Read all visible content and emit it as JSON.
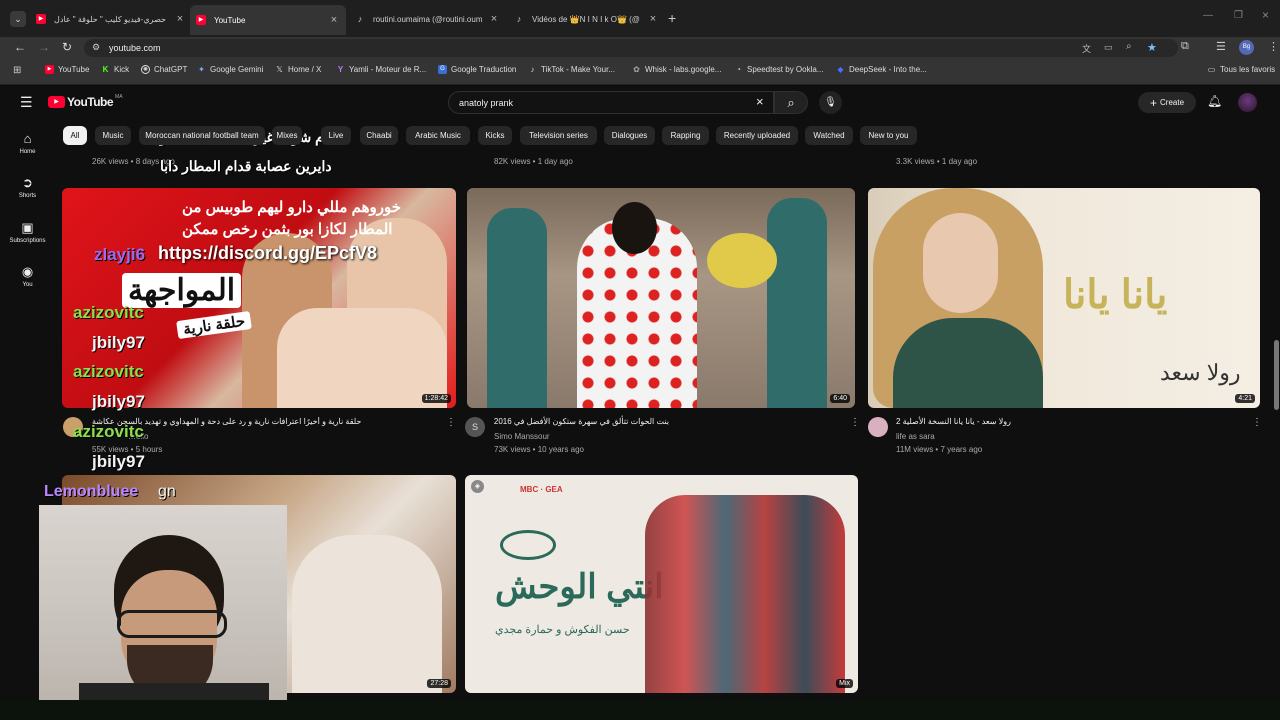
{
  "browser": {
    "tabs": [
      {
        "title": "حصري-فيديو كليب \" حلوفة \" عادل",
        "icon": "youtube-icon"
      },
      {
        "title": "YouTube",
        "icon": "youtube-icon"
      },
      {
        "title": "routini.oumaima (@routini.oum",
        "icon": "tiktok-icon"
      },
      {
        "title": "Vidéos de 👑N I N I k O👑 (@",
        "icon": "tiktok-icon"
      }
    ],
    "new_tab": "+",
    "address": "youtube.com",
    "bookmarks": [
      {
        "label": "YouTube",
        "icon": "youtube-icon"
      },
      {
        "label": "Kick",
        "icon": "kick-icon"
      },
      {
        "label": "ChatGPT",
        "icon": "chatgpt-icon"
      },
      {
        "label": "Google Gemini",
        "icon": "gemini-icon"
      },
      {
        "label": "Home / X",
        "icon": "x-icon"
      },
      {
        "label": "Yamli - Moteur de R...",
        "icon": "yamli-icon"
      },
      {
        "label": "Google Traduction",
        "icon": "translate-icon"
      },
      {
        "label": "TikTok - Make Your...",
        "icon": "tiktok-icon"
      },
      {
        "label": "Whisk - labs.google...",
        "icon": "whisk-icon"
      },
      {
        "label": "Speedtest by Ookla...",
        "icon": "speedtest-icon"
      },
      {
        "label": "DeepSeek - Into the...",
        "icon": "deepseek-icon"
      }
    ],
    "all_bookmarks": "Tous les favoris",
    "profile_initials": "Bg"
  },
  "youtube": {
    "logo": "YouTube",
    "country": "MA",
    "search_value": "anatoly prank",
    "create": "Create",
    "sidebar": [
      {
        "label": "Home",
        "icon": "home-icon"
      },
      {
        "label": "Shorts",
        "icon": "shorts-icon"
      },
      {
        "label": "Subscriptions",
        "icon": "subscriptions-icon"
      },
      {
        "label": "You",
        "icon": "you-icon"
      }
    ],
    "chips": [
      "All",
      "Music",
      "Moroccan national football team",
      "Mixes",
      "Live",
      "Chaabi",
      "Arabic Music",
      "Kicks",
      "Television series",
      "Dialogues",
      "Rapping",
      "Recently uploaded",
      "Watched",
      "New to you"
    ],
    "top_meta": [
      "26K views • 8 days ago",
      "82K views • 1 day ago",
      "3.3K views • 1 day ago"
    ],
    "videos": [
      {
        "title": "حلقة نارية و أخيرًا اعترافات نارية و رد على دحة و المهداوي و تهديد بالسجن عكاشة",
        "channel": "…ello",
        "meta": "55K views • 5 hours",
        "duration": "1:28:42"
      },
      {
        "title": "بنت الحوات تتألق في سهرة ستكون الأفضل في 2016",
        "channel": "Simo Manssour",
        "meta": "73K views • 10 years ago",
        "duration": "6:40"
      },
      {
        "title": "رولا سعد - يانا يانا النسخة الأصلية 2",
        "channel": "life as sara",
        "meta": "11M views • 7 years ago",
        "duration": "4:21"
      },
      {
        "duration": "27:28"
      },
      {
        "duration": "Mix"
      }
    ]
  },
  "overlay": {
    "discord": "https://discord.gg/EPcfV8",
    "headline1": "العام شوف غير الطاكسيات كانو",
    "headline2": "دايرين عصابة قدام المطار دابا",
    "thumb1_text1": "خوروهم مللي دارو ليهم طوبيس من",
    "thumb1_text2": "المطار لكازا بور بثمن رخص ممكن",
    "thumb1_big": "المواجهة",
    "thumb1_tag": "حلقة نارية",
    "thumb3_text": "يانا يانا",
    "thumb3_sub": "رولا سعد",
    "thumb5_title": "انتي الوحش",
    "thumb5_sub": "حسن الفكوش و حمارة مجدي",
    "chat": [
      "zlayji6",
      "azizovitc",
      "jbily97",
      "azizovitc",
      "jbily97",
      "azizovitc",
      "jbily97",
      "Lemonbluee",
      "gn"
    ]
  }
}
